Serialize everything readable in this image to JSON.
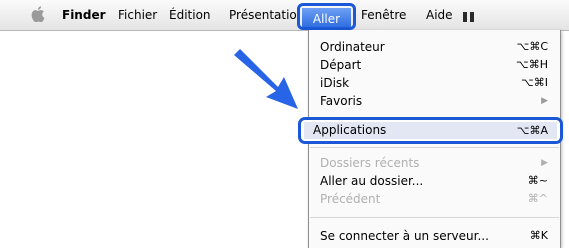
{
  "menubar": {
    "items": [
      "Finder",
      "Fichier",
      "Édition",
      "Présentation",
      "Aller",
      "Fenêtre",
      "Aide"
    ],
    "apple_icon": "apple-icon",
    "extra_icon": "menu-extra-icon"
  },
  "menu": {
    "items": [
      {
        "label": "Ordinateur",
        "shortcut": "⌥⌘C",
        "enabled": true
      },
      {
        "label": "Départ",
        "shortcut": "⌥⌘H",
        "enabled": true
      },
      {
        "label": "iDisk",
        "shortcut": "⌥⌘I",
        "enabled": true
      },
      {
        "label": "Favoris",
        "shortcut": "▶",
        "enabled": true
      },
      {
        "label": "Applications",
        "shortcut": "⌥⌘A",
        "enabled": true,
        "highlighted": true
      },
      {
        "label": "Dossiers récents",
        "shortcut": "▶",
        "enabled": false
      },
      {
        "label": "Aller au dossier...",
        "shortcut": "⌘~",
        "enabled": true
      },
      {
        "label": "Précédent",
        "shortcut": "⌘^",
        "enabled": false
      },
      {
        "label": "Se connecter à un serveur...",
        "shortcut": "⌘K",
        "enabled": true
      }
    ]
  },
  "colors": {
    "highlight_border": "#1b58d8",
    "arrow": "#2864e6",
    "menu_highlight": "#2f6de0"
  }
}
